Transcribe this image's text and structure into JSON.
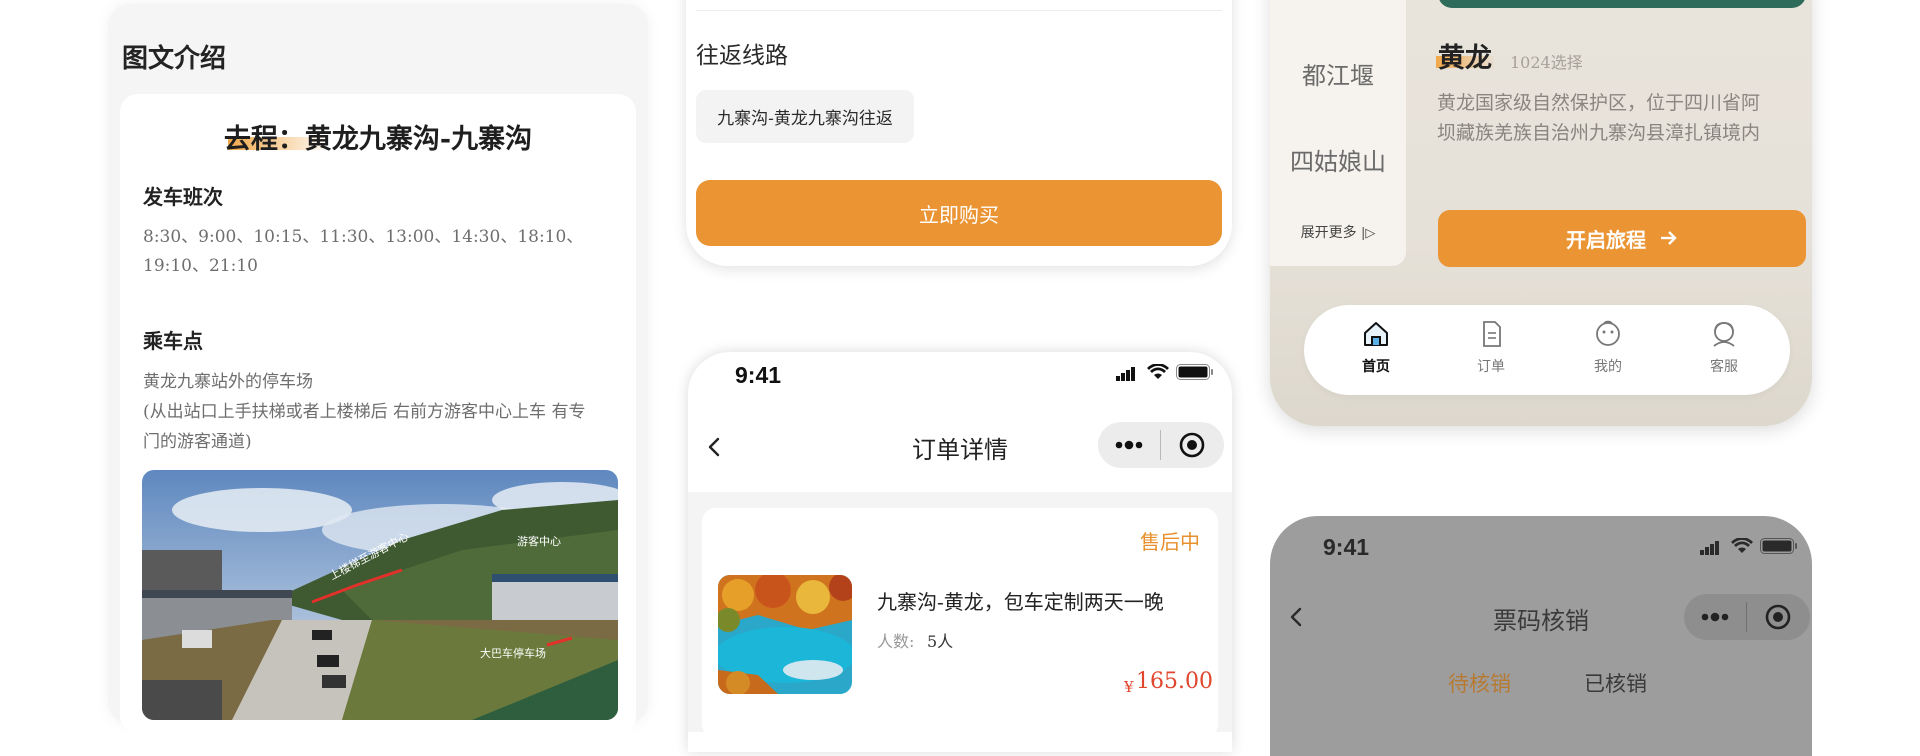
{
  "col1": {
    "section_title": "图文介绍",
    "route_title": "去程：黄龙九寨沟-九寨沟",
    "schedule_label": "发车班次",
    "schedule_line1": "8:30、9:00、10:15、11:30、13:00、14:30、18:10、",
    "schedule_line2": "19:10、21:10",
    "pickup_label": "乘车点",
    "pickup_line1": "黄龙九寨站外的停车场",
    "pickup_line2": "(从出站口上手扶梯或者上楼梯后 右前方游客中心上车 有专",
    "pickup_line3": "门的游客通道)",
    "photo_labels": {
      "upstairs": "上楼梯至游客中心",
      "visitor_center": "游客中心",
      "bus_parking": "大巴车停车场"
    }
  },
  "col2": {
    "roundtrip_label": "往返线路",
    "route_chip": "九寨沟-黄龙九寨沟往返",
    "buy_button": "立即购买",
    "status_time": "9:41",
    "nav_title": "订单详情",
    "order_status": "售后中",
    "product_name": "九寨沟-黄龙，包车定制两天一晚",
    "people_label": "人数:",
    "people_value": "5人",
    "price_symbol": "¥",
    "price_value": "165.00"
  },
  "col3": {
    "side_items": [
      "都江堰",
      "四姑娘山"
    ],
    "more_link": "展开更多",
    "place_name": "黄龙",
    "place_sub": "1024选择",
    "place_desc": "黄龙国家级自然保护区，位于四川省阿坝藏族羌族自治州九寨沟县漳扎镇境内",
    "start_button": "开启旅程",
    "tabs": [
      "首页",
      "订单",
      "我的",
      "客服"
    ],
    "status_time": "9:41",
    "nav_title": "票码核销",
    "tab_pending": "待核销",
    "tab_done": "已核销"
  },
  "colors": {
    "accent": "#ea9434",
    "price_red": "#e0462c",
    "status_orange": "#e8902e"
  }
}
